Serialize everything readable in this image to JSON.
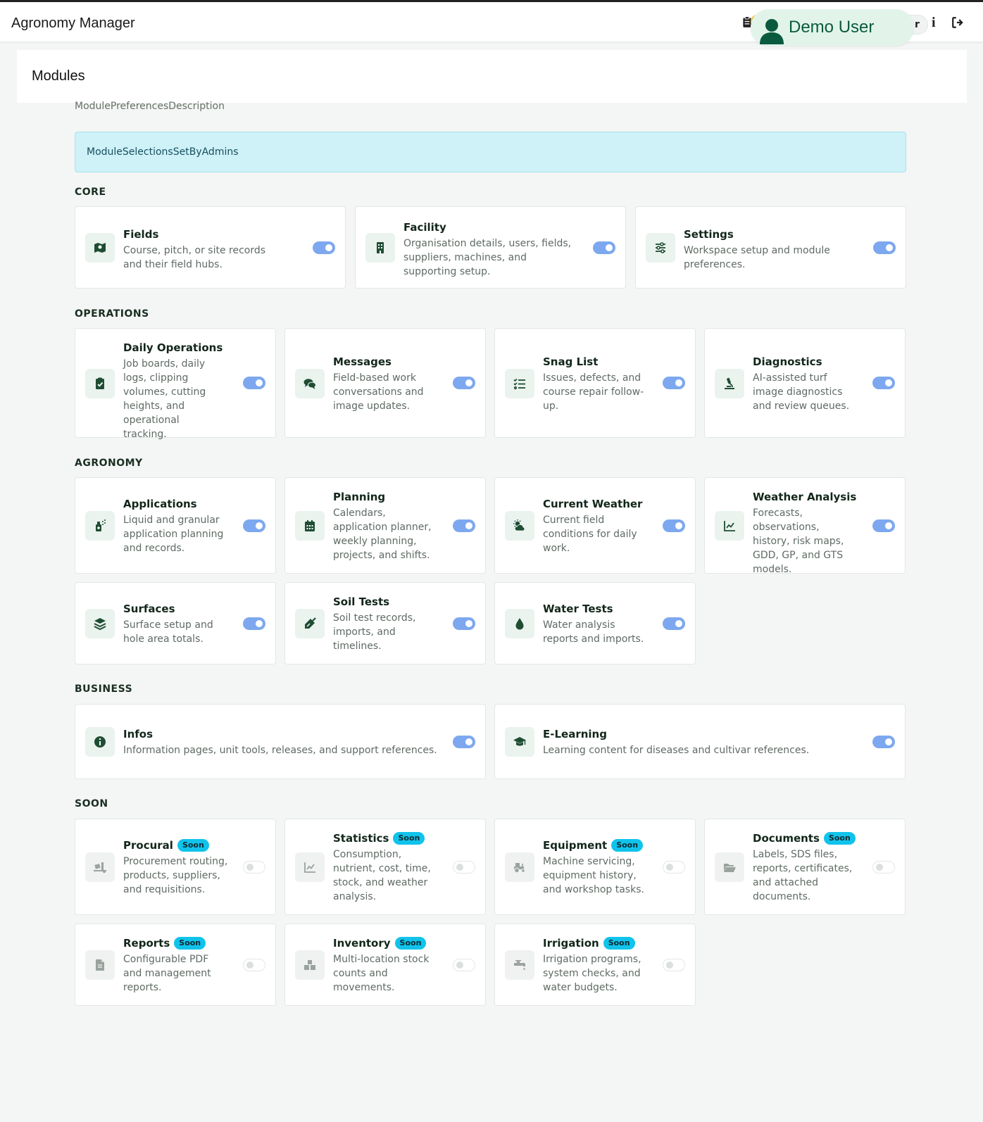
{
  "app": {
    "title": "Agronomy Manager"
  },
  "topbar": {
    "user_name": "Demo User",
    "user_tail": "r",
    "info_glyph": "i"
  },
  "page": {
    "heading": "Modules",
    "description": "ModulePreferencesDescription",
    "notice": "ModuleSelectionsSetByAdmins"
  },
  "sections": {
    "core": "CORE",
    "operations": "OPERATIONS",
    "agronomy": "AGRONOMY",
    "business": "BUSINESS",
    "soon": "SOON"
  },
  "soon_badge": "Soon",
  "modules": {
    "fields": {
      "title": "Fields",
      "text": "Course, pitch, or site records and their field hubs.",
      "enabled": true,
      "icon": "map-icon"
    },
    "facility": {
      "title": "Facility",
      "text": "Organisation details, users, fields, suppliers, machines, and supporting setup.",
      "enabled": true,
      "icon": "building-icon"
    },
    "settings": {
      "title": "Settings",
      "text": "Workspace setup and module preferences.",
      "enabled": true,
      "icon": "sliders-icon"
    },
    "daily_operations": {
      "title": "Daily Operations",
      "text": "Job boards, daily logs, clipping volumes, cutting heights, and operational tracking.",
      "enabled": true,
      "icon": "clipboard-check-icon"
    },
    "messages": {
      "title": "Messages",
      "text": "Field-based work conversations and image updates.",
      "enabled": true,
      "icon": "comments-icon"
    },
    "snag_list": {
      "title": "Snag List",
      "text": "Issues, defects, and course repair follow-up.",
      "enabled": true,
      "icon": "list-check-icon"
    },
    "diagnostics": {
      "title": "Diagnostics",
      "text": "AI-assisted turf image diagnostics and review queues.",
      "enabled": true,
      "icon": "microscope-icon"
    },
    "applications": {
      "title": "Applications",
      "text": "Liquid and granular application planning and records.",
      "enabled": true,
      "icon": "spray-can-icon"
    },
    "planning": {
      "title": "Planning",
      "text": "Calendars, application planner, weekly planning, projects, and shifts.",
      "enabled": true,
      "icon": "calendar-icon"
    },
    "current_weather": {
      "title": "Current Weather",
      "text": "Current field conditions for daily work.",
      "enabled": true,
      "icon": "cloud-sun-icon"
    },
    "weather_analysis": {
      "title": "Weather Analysis",
      "text": "Forecasts, observations, history, risk maps, GDD, GP, and GTS models.",
      "enabled": true,
      "icon": "chart-line-icon"
    },
    "surfaces": {
      "title": "Surfaces",
      "text": "Surface setup and hole area totals.",
      "enabled": true,
      "icon": "layers-icon"
    },
    "soil_tests": {
      "title": "Soil Tests",
      "text": "Soil test records, imports, and timelines.",
      "enabled": true,
      "icon": "trowel-icon"
    },
    "water_tests": {
      "title": "Water Tests",
      "text": "Water analysis reports and imports.",
      "enabled": true,
      "icon": "droplet-icon"
    },
    "infos": {
      "title": "Infos",
      "text": "Information pages, unit tools, releases, and support references.",
      "enabled": true,
      "icon": "info-circle-icon"
    },
    "e_learning": {
      "title": "E-Learning",
      "text": "Learning content for diseases and cultivar references.",
      "enabled": true,
      "icon": "graduation-cap-icon"
    },
    "procural": {
      "title": "Procural",
      "text": "Procurement routing, products, suppliers, and requisitions.",
      "enabled": false,
      "icon": "truck-ramp-icon"
    },
    "statistics": {
      "title": "Statistics",
      "text": "Consumption, nutrient, cost, time, stock, and weather analysis.",
      "enabled": false,
      "icon": "chart-line-icon"
    },
    "equipment": {
      "title": "Equipment",
      "text": "Machine servicing, equipment history, and workshop tasks.",
      "enabled": false,
      "icon": "tractor-icon"
    },
    "documents": {
      "title": "Documents",
      "text": "Labels, SDS files, reports, certificates, and attached documents.",
      "enabled": false,
      "icon": "folder-open-icon"
    },
    "reports": {
      "title": "Reports",
      "text": "Configurable PDF and management reports.",
      "enabled": false,
      "icon": "file-icon"
    },
    "inventory": {
      "title": "Inventory",
      "text": "Multi-location stock counts and movements.",
      "enabled": false,
      "icon": "boxes-icon"
    },
    "irrigation": {
      "title": "Irrigation",
      "text": "Irrigation programs, system checks, and water budgets.",
      "enabled": false,
      "icon": "faucet-icon"
    }
  },
  "colors": {
    "accent": "#0b5a3f",
    "toggle_on": "#7da8ef",
    "badge": "#11c3eb",
    "notice_bg": "#cff1f8"
  }
}
